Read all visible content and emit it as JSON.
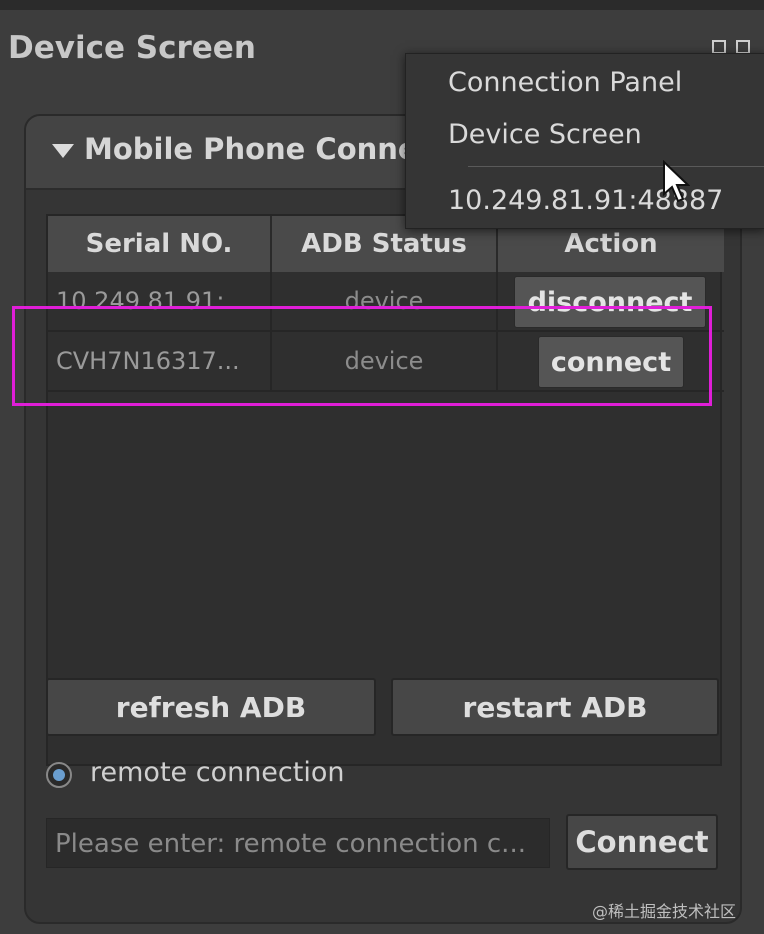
{
  "window": {
    "title": "Device Screen"
  },
  "panel": {
    "title": "Mobile Phone Connect"
  },
  "table": {
    "headers": [
      "Serial NO.",
      "ADB Status",
      "Action"
    ],
    "rows": [
      {
        "serial": "10.249.81.91:",
        "status": "device",
        "action": "disconnect"
      },
      {
        "serial": "CVH7N16317...",
        "status": "device",
        "action": "connect"
      }
    ]
  },
  "buttons": {
    "refresh": "refresh ADB",
    "restart": "restart ADB",
    "connect": "Connect"
  },
  "remote": {
    "radio_label": "remote connection",
    "input_placeholder": "Please enter: remote connection c..."
  },
  "menu": {
    "items": [
      "Connection Panel",
      "Device Screen",
      "10.249.81.91:48887"
    ]
  },
  "watermark": "@稀土掘金技术社区",
  "colors": {
    "highlight": "#e01ed8",
    "radio_dot": "#6a9ecf"
  }
}
